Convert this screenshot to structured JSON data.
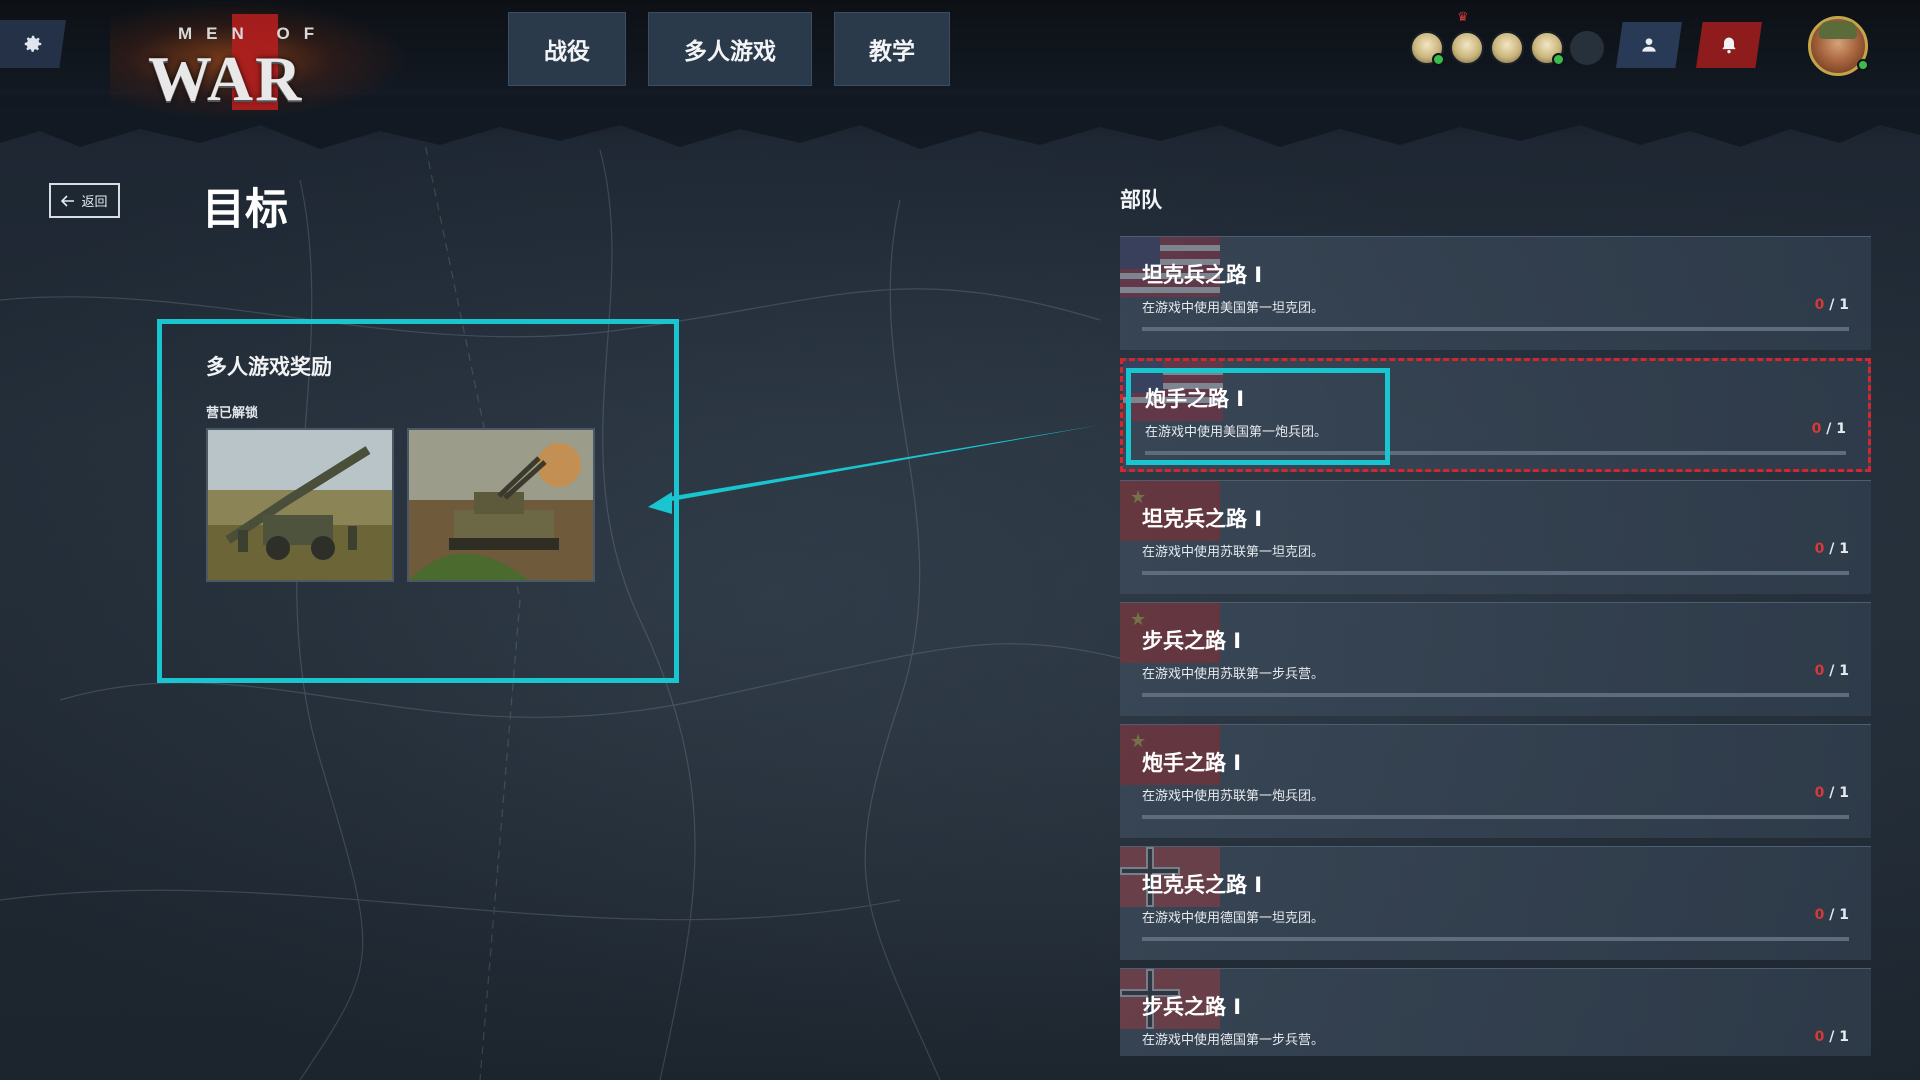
{
  "header": {
    "logo_top": "MEN OF",
    "logo_main": "WAR",
    "tabs": [
      {
        "label": "战役"
      },
      {
        "label": "多人游戏"
      },
      {
        "label": "教学"
      }
    ],
    "squad_slots": [
      {
        "state": "ready"
      },
      {
        "state": "ready"
      },
      {
        "state": "ready"
      },
      {
        "state": "ready"
      },
      {
        "state": "empty"
      }
    ]
  },
  "left": {
    "back_label": "返回",
    "page_title": "目标",
    "reward_title": "多人游戏奖励",
    "reward_sub": "营已解锁"
  },
  "right": {
    "header": "部队",
    "objectives": [
      {
        "title": "坦克兵之路 I",
        "desc": "在游戏中使用美国第一坦克团。",
        "current": "0",
        "total": "1",
        "flag": "usa"
      },
      {
        "title": "炮手之路 I",
        "desc": "在游戏中使用美国第一炮兵团。",
        "current": "0",
        "total": "1",
        "flag": "usa"
      },
      {
        "title": "坦克兵之路 I",
        "desc": "在游戏中使用苏联第一坦克团。",
        "current": "0",
        "total": "1",
        "flag": "ussr"
      },
      {
        "title": "步兵之路 I",
        "desc": "在游戏中使用苏联第一步兵营。",
        "current": "0",
        "total": "1",
        "flag": "ussr"
      },
      {
        "title": "炮手之路 I",
        "desc": "在游戏中使用苏联第一炮兵团。",
        "current": "0",
        "total": "1",
        "flag": "ussr"
      },
      {
        "title": "坦克兵之路 I",
        "desc": "在游戏中使用德国第一坦克团。",
        "current": "0",
        "total": "1",
        "flag": "germany"
      },
      {
        "title": "步兵之路 I",
        "desc": "在游戏中使用德国第一步兵营。",
        "current": "0",
        "total": "1",
        "flag": "germany"
      }
    ]
  },
  "colors": {
    "highlight": "#19c6cf",
    "selected_border": "#d4262c",
    "progress_current": "#d43a3a",
    "notif_button": "#8e1c1c",
    "friends_button": "#283a55"
  },
  "icons": [
    "gear-icon",
    "users-icon",
    "bell-icon",
    "arrow-left-icon",
    "crown-icon"
  ]
}
